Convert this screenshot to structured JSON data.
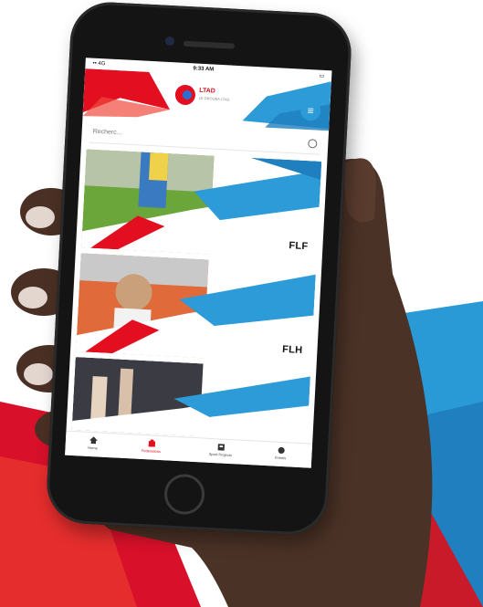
{
  "colors": {
    "red": "#e30e1f",
    "blue": "#2c9bd8",
    "skin": "#4b3226"
  },
  "status_bar": {
    "carrier": "•• 4G",
    "time": "9:33 AM",
    "battery": ""
  },
  "header": {
    "logo_title": "LTAD",
    "logo_subtitle": "LE DROUBA LTAD",
    "menu_icon": "menu-icon"
  },
  "search": {
    "placeholder": "Recherc..."
  },
  "cards": [
    {
      "code": "FLF",
      "sport": "football"
    },
    {
      "code": "FLH",
      "sport": "handball"
    },
    {
      "code": "",
      "sport": "volleyball"
    }
  ],
  "tabs": [
    {
      "label": "Home",
      "icon": "home-icon",
      "active": false
    },
    {
      "label": "Federations",
      "icon": "federation-icon",
      "active": true
    },
    {
      "label": "Sport Projects",
      "icon": "projects-icon",
      "active": false
    },
    {
      "label": "Events",
      "icon": "events-icon",
      "active": false
    }
  ]
}
